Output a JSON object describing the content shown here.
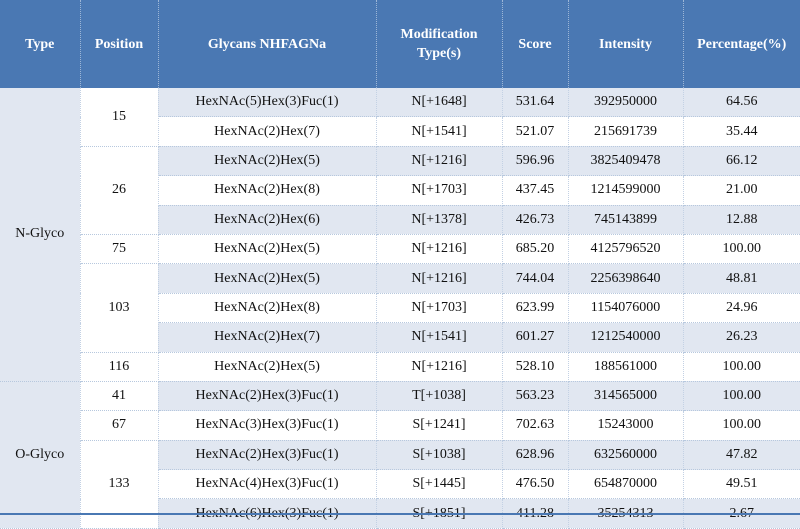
{
  "header": {
    "type": "Type",
    "position": "Position",
    "glycans": "Glycans NHFAGNa",
    "modification": "Modification Type(s)",
    "score": "Score",
    "intensity": "Intensity",
    "percentage": "Percentage(%)"
  },
  "groups": [
    {
      "type": "N-Glyco",
      "positions": [
        {
          "position": "15",
          "rows": [
            {
              "glycan": "HexNAc(5)Hex(3)Fuc(1)",
              "mod": "N[+1648]",
              "score": "531.64",
              "intensity": "392950000",
              "percentage": "64.56"
            },
            {
              "glycan": "HexNAc(2)Hex(7)",
              "mod": "N[+1541]",
              "score": "521.07",
              "intensity": "215691739",
              "percentage": "35.44"
            }
          ]
        },
        {
          "position": "26",
          "rows": [
            {
              "glycan": "HexNAc(2)Hex(5)",
              "mod": "N[+1216]",
              "score": "596.96",
              "intensity": "3825409478",
              "percentage": "66.12"
            },
            {
              "glycan": "HexNAc(2)Hex(8)",
              "mod": "N[+1703]",
              "score": "437.45",
              "intensity": "1214599000",
              "percentage": "21.00"
            },
            {
              "glycan": "HexNAc(2)Hex(6)",
              "mod": "N[+1378]",
              "score": "426.73",
              "intensity": "745143899",
              "percentage": "12.88"
            }
          ]
        },
        {
          "position": "75",
          "rows": [
            {
              "glycan": "HexNAc(2)Hex(5)",
              "mod": "N[+1216]",
              "score": "685.20",
              "intensity": "4125796520",
              "percentage": "100.00"
            }
          ]
        },
        {
          "position": "103",
          "rows": [
            {
              "glycan": "HexNAc(2)Hex(5)",
              "mod": "N[+1216]",
              "score": "744.04",
              "intensity": "2256398640",
              "percentage": "48.81"
            },
            {
              "glycan": "HexNAc(2)Hex(8)",
              "mod": "N[+1703]",
              "score": "623.99",
              "intensity": "1154076000",
              "percentage": "24.96"
            },
            {
              "glycan": "HexNAc(2)Hex(7)",
              "mod": "N[+1541]",
              "score": "601.27",
              "intensity": "1212540000",
              "percentage": "26.23"
            }
          ]
        },
        {
          "position": "116",
          "rows": [
            {
              "glycan": "HexNAc(2)Hex(5)",
              "mod": "N[+1216]",
              "score": "528.10",
              "intensity": "188561000",
              "percentage": "100.00"
            }
          ]
        }
      ]
    },
    {
      "type": "O-Glyco",
      "positions": [
        {
          "position": "41",
          "rows": [
            {
              "glycan": "HexNAc(2)Hex(3)Fuc(1)",
              "mod": "T[+1038]",
              "score": "563.23",
              "intensity": "314565000",
              "percentage": "100.00"
            }
          ]
        },
        {
          "position": "67",
          "rows": [
            {
              "glycan": "HexNAc(3)Hex(3)Fuc(1)",
              "mod": "S[+1241]",
              "score": "702.63",
              "intensity": "15243000",
              "percentage": "100.00"
            }
          ]
        },
        {
          "position": "133",
          "rows": [
            {
              "glycan": "HexNAc(2)Hex(3)Fuc(1)",
              "mod": "S[+1038]",
              "score": "628.96",
              "intensity": "632560000",
              "percentage": "47.82"
            },
            {
              "glycan": "HexNAc(4)Hex(3)Fuc(1)",
              "mod": "S[+1445]",
              "score": "476.50",
              "intensity": "654870000",
              "percentage": "49.51"
            },
            {
              "glycan": "HexNAc(6)Hex(3)Fuc(1)",
              "mod": "S[+1851]",
              "score": "411.28",
              "intensity": "35254313",
              "percentage": "2.67"
            }
          ]
        }
      ]
    }
  ]
}
